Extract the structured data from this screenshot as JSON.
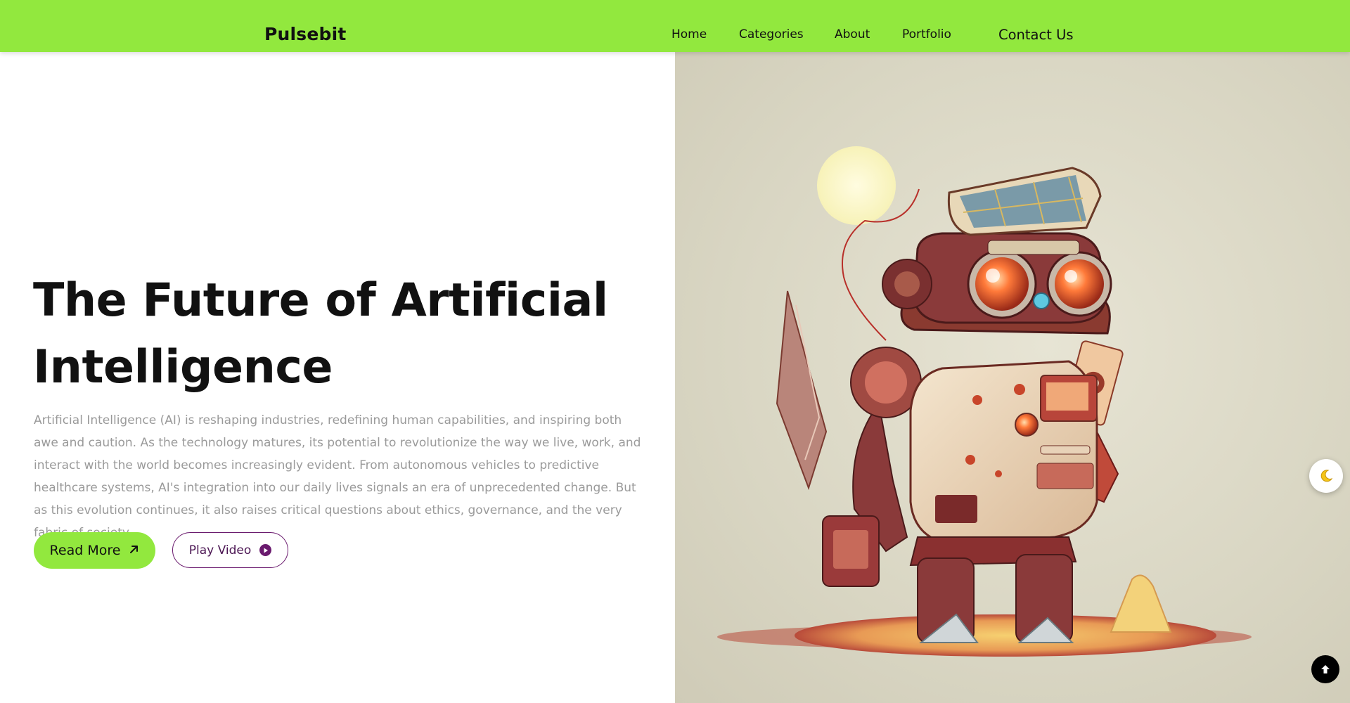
{
  "brand": {
    "name": "Pulsebit"
  },
  "nav": {
    "items": [
      {
        "label": "Home"
      },
      {
        "label": "Categories"
      },
      {
        "label": "About"
      },
      {
        "label": "Portfolio"
      },
      {
        "label": "Contact Us"
      }
    ]
  },
  "hero": {
    "title": "The Future of Artificial Intelligence",
    "description": "Artificial Intelligence (AI) is reshaping industries, redefining human capabilities, and inspiring both awe and caution. As the technology matures, its potential to revolutionize the way we live, work, and interact with the world becomes increasingly evident. From autonomous vehicles to predictive healthcare systems, AI's integration into our daily lives signals an era of unprecedented change. But as this evolution continues, it also raises critical questions about ethics, governance, and the very fabric of society.",
    "read_more_label": "Read More",
    "play_video_label": "Play Video"
  },
  "icons": {
    "read_more": "arrow-up-right-icon",
    "play_video": "play-circle-icon",
    "theme_toggle": "moon-icon",
    "back_to_top": "arrow-up-icon"
  },
  "colors": {
    "accent": "#92e83e",
    "play_button": "#6a1a6e",
    "text_dark": "#111111",
    "text_muted": "#9a9a9a"
  }
}
